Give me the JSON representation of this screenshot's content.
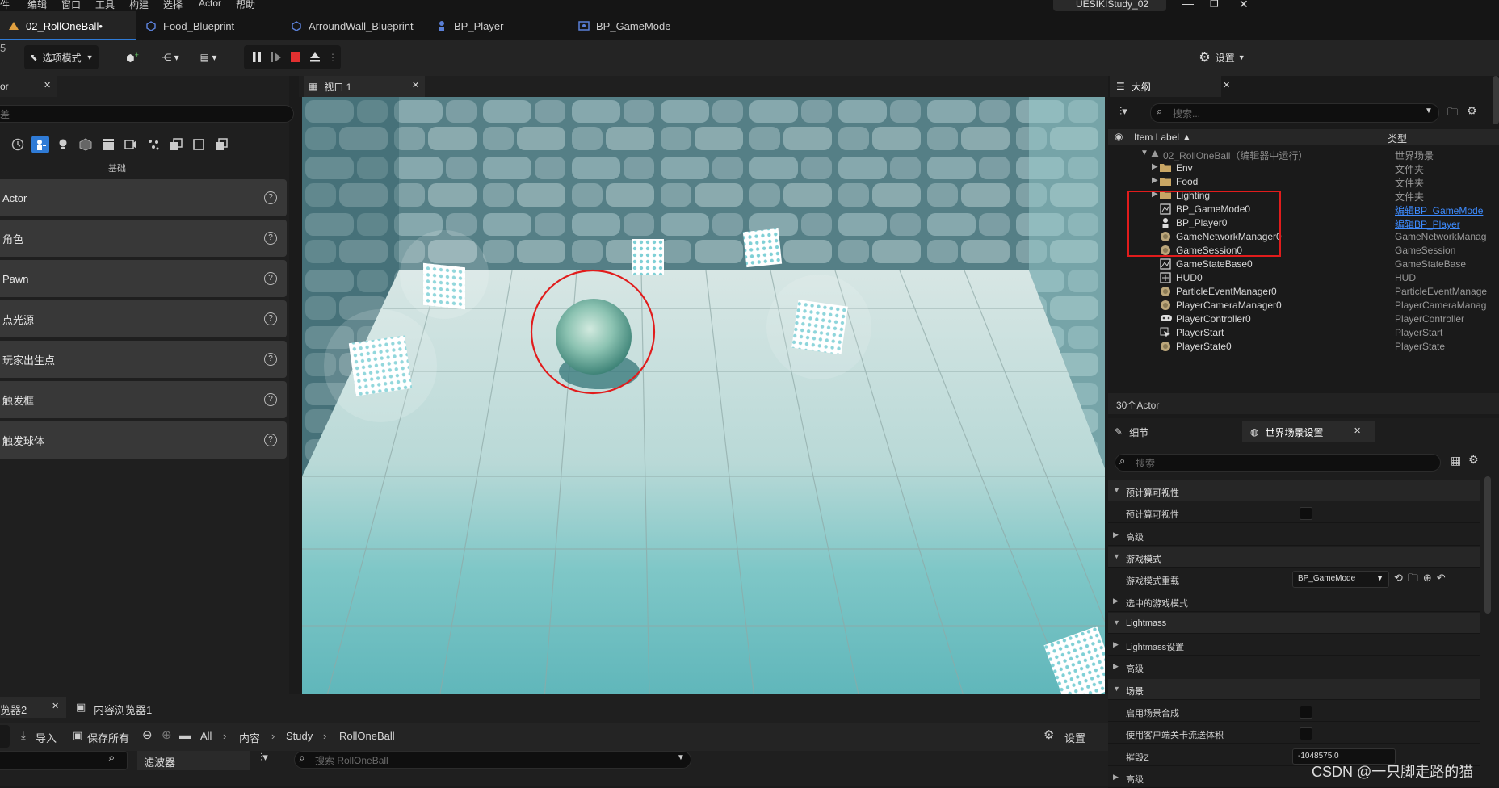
{
  "menu": [
    "件",
    "编辑",
    "窗口",
    "工具",
    "构建",
    "选择",
    "Actor",
    "帮助"
  ],
  "project_name": "UESIKIStudy_02",
  "tabs": [
    {
      "label": "02_RollOneBall•"
    },
    {
      "label": "Food_Blueprint"
    },
    {
      "label": "ArroundWall_Blueprint"
    },
    {
      "label": "BP_Player"
    },
    {
      "label": "BP_GameMode"
    }
  ],
  "toolbar": {
    "mode_label": "选项模式",
    "settings_label": "设置",
    "left_edge_glyph": "5"
  },
  "left_panel": {
    "tab_label": "or",
    "group_label": "基础",
    "search_placeholder": "差",
    "categories": [
      "Actor",
      "角色",
      "Pawn",
      "点光源",
      "玩家出生点",
      "触发框",
      "触发球体"
    ]
  },
  "viewport": {
    "tab_label": "视口 1"
  },
  "outliner": {
    "tab_label": "大纲",
    "search_placeholder": "搜索...",
    "col_label": "Item Label ▲",
    "col_type": "类型",
    "root": {
      "label": "02_RollOneBall（编辑器中运行）",
      "type": "世界场景"
    },
    "items": [
      {
        "label": "Env",
        "type": "文件夹",
        "icon": "folder-icon"
      },
      {
        "label": "Food",
        "type": "文件夹",
        "icon": "folder-icon"
      },
      {
        "label": "Lighting",
        "type": "文件夹",
        "icon": "folder-icon"
      },
      {
        "label": "BP_GameMode0",
        "type": "编辑BP_GameMode",
        "icon": "gamemode-icon"
      },
      {
        "label": "BP_Player0",
        "type": "编辑BP_Player",
        "icon": "player-icon"
      },
      {
        "label": "GameNetworkManager0",
        "type": "GameNetworkManag",
        "icon": "actor-icon"
      },
      {
        "label": "GameSession0",
        "type": "GameSession",
        "icon": "actor-icon"
      },
      {
        "label": "GameStateBase0",
        "type": "GameStateBase",
        "icon": "gamestate-icon"
      },
      {
        "label": "HUD0",
        "type": "HUD",
        "icon": "hud-icon"
      },
      {
        "label": "ParticleEventManager0",
        "type": "ParticleEventManage",
        "icon": "actor-icon"
      },
      {
        "label": "PlayerCameraManager0",
        "type": "PlayerCameraManag",
        "icon": "actor-icon"
      },
      {
        "label": "PlayerController0",
        "type": "PlayerController",
        "icon": "controller-icon"
      },
      {
        "label": "PlayerStart",
        "type": "PlayerStart",
        "icon": "playerstart-icon"
      },
      {
        "label": "PlayerState0",
        "type": "PlayerState",
        "icon": "actor-icon"
      }
    ],
    "actor_count": "30个Actor"
  },
  "details": {
    "tab_details": "细节",
    "tab_world": "世界场景设置",
    "search_placeholder": "搜索",
    "rows": [
      {
        "label": "预计算可视性",
        "section": true,
        "open": true
      },
      {
        "label": "预计算可视性",
        "section": false,
        "checkbox": true
      },
      {
        "label": "高级",
        "section": false,
        "collapsed": true
      },
      {
        "label": "游戏模式",
        "section": true,
        "open": true
      },
      {
        "label": "游戏模式重载",
        "section": false,
        "dropdown": "BP_GameMode"
      },
      {
        "label": "选中的游戏模式",
        "section": false,
        "collapsed": true
      },
      {
        "label": "Lightmass",
        "section": true,
        "open": true
      },
      {
        "label": "Lightmass设置",
        "section": false,
        "collapsed": true
      },
      {
        "label": "高级",
        "section": false,
        "collapsed": true
      },
      {
        "label": "场景",
        "section": true,
        "open": true
      },
      {
        "label": "启用场景合成",
        "section": false,
        "checkbox": true
      },
      {
        "label": "使用客户端关卡流送体积",
        "section": false,
        "checkbox": true
      },
      {
        "label": "摧毁Z",
        "section": false,
        "value": "-1048575.0"
      },
      {
        "label": "高级",
        "section": false,
        "collapsed": true
      }
    ]
  },
  "bottom": {
    "tab1": "览器2",
    "tab2": "内容浏览器1",
    "import": "导入",
    "save_all": "保存所有",
    "crumbs": [
      "All",
      "内容",
      "Study",
      "RollOneBall"
    ],
    "settings": "设置",
    "filter": "滤波器",
    "search_placeholder": "搜索 RollOneBall"
  },
  "watermark": "CSDN @一只脚走路的猫",
  "colors": {
    "accent": "#2f7bd6",
    "annotation_red": "#e11c1c",
    "link": "#3d8bff"
  }
}
